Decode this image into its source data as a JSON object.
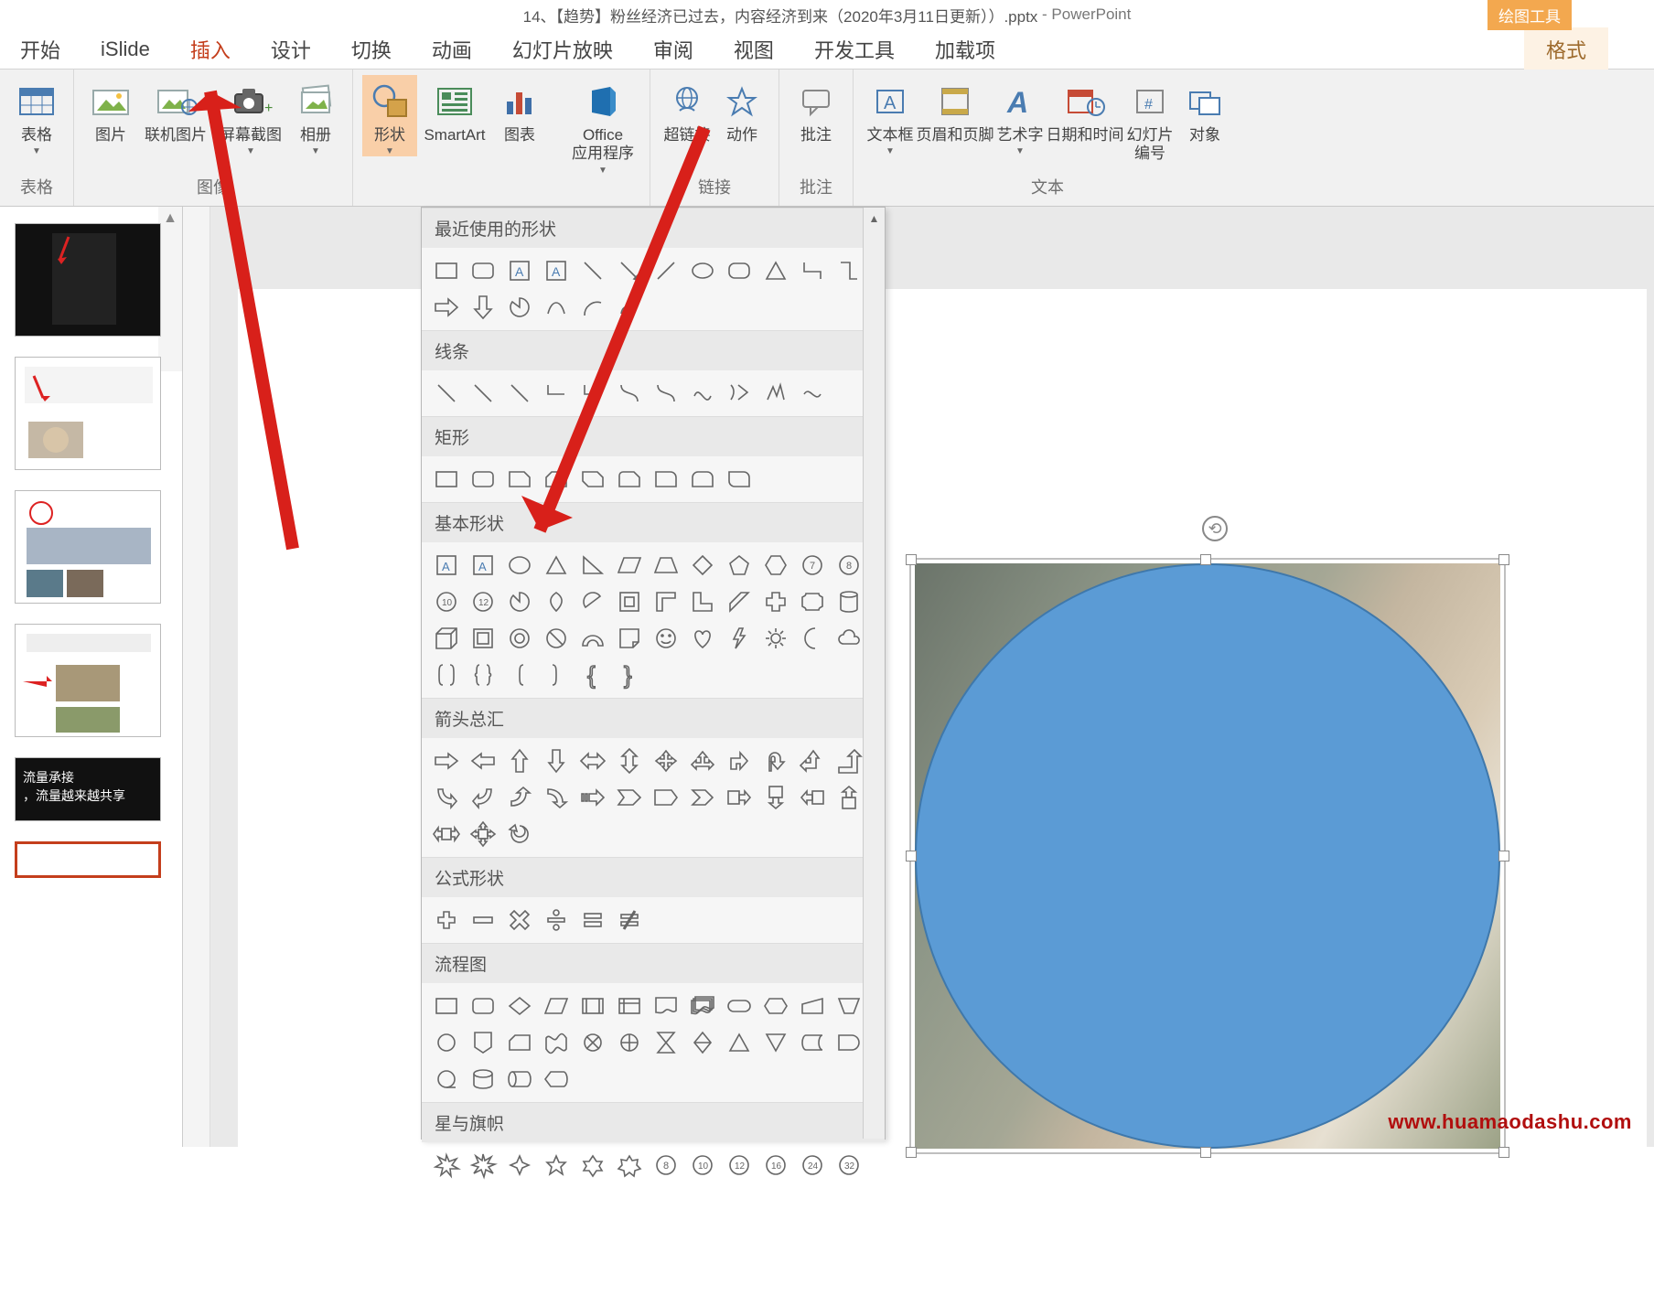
{
  "title": {
    "doc": "14、【趋势】粉丝经济已过去，内容经济到来（2020年3月11日更新））.pptx",
    "app": "PowerPoint",
    "contextual": "绘图工具"
  },
  "tabs": {
    "t0": "开始",
    "t1": "iSlide",
    "t2": "插入",
    "t3": "设计",
    "t4": "切换",
    "t5": "动画",
    "t6": "幻灯片放映",
    "t7": "审阅",
    "t8": "视图",
    "t9": "开发工具",
    "t10": "加载项",
    "ctx": "格式"
  },
  "ribbon": {
    "group_tables": "表格",
    "group_images": "图像",
    "group_links": "链接",
    "group_comments": "批注",
    "group_text": "文本",
    "table": "表格",
    "pictures": "图片",
    "online_pic": "联机图片",
    "screenshot": "屏幕截图",
    "album": "相册",
    "shapes": "形状",
    "smartart": "SmartArt",
    "chart": "图表",
    "office_apps": "Office\n应用程序",
    "hyperlink": "超链接",
    "action": "动作",
    "comment": "批注",
    "textbox": "文本框",
    "headerfooter": "页眉和页脚",
    "wordart": "艺术字",
    "datetime": "日期和时间",
    "slidenum": "幻灯片\n编号",
    "object": "对象"
  },
  "shapes_panel": {
    "recent": "最近使用的形状",
    "lines": "线条",
    "rects": "矩形",
    "basic": "基本形状",
    "arrows": "箭头总汇",
    "equation": "公式形状",
    "flow": "流程图",
    "stars": "星与旗帜"
  },
  "thumb_text": {
    "l1": "流量承接",
    "l2": "，流量越来越共享"
  },
  "watermark": "www.huamaodashu.com"
}
